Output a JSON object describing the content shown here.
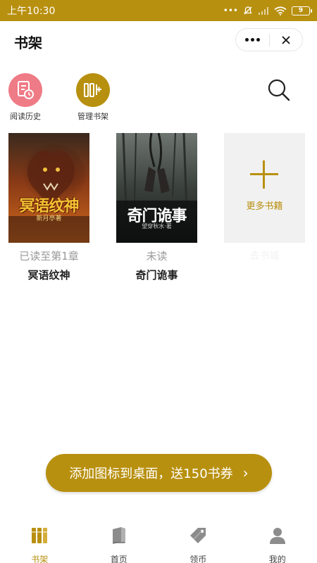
{
  "status_bar": {
    "time": "上午10:30",
    "battery": "9"
  },
  "header": {
    "title": "书架"
  },
  "quick_actions": {
    "history_label": "阅读历史",
    "manage_label": "管理书架"
  },
  "books": [
    {
      "title": "冥语纹神",
      "progress": "已读至第1章",
      "cover_title": "冥语纹神",
      "cover_author": "新月亭著"
    },
    {
      "title": "奇门诡事",
      "progress": "未读",
      "cover_title": "奇门诡事",
      "cover_author": "望穿秋水·著"
    }
  ],
  "add_more": {
    "label": "更多书籍",
    "sub_label": "去书城"
  },
  "banner": {
    "text": "添加图标到桌面，送150书券",
    "arrow": "›"
  },
  "tabs": [
    {
      "label": "书架",
      "icon": "bookshelf-icon",
      "active": true
    },
    {
      "label": "首页",
      "icon": "book-home-icon",
      "active": false
    },
    {
      "label": "领币",
      "icon": "coin-tag-icon",
      "active": false
    },
    {
      "label": "我的",
      "icon": "user-icon",
      "active": false
    }
  ],
  "colors": {
    "accent": "#b8900f",
    "history_icon_bg": "#ef7b86",
    "inactive_tab_icon": "#8c8c8c"
  }
}
